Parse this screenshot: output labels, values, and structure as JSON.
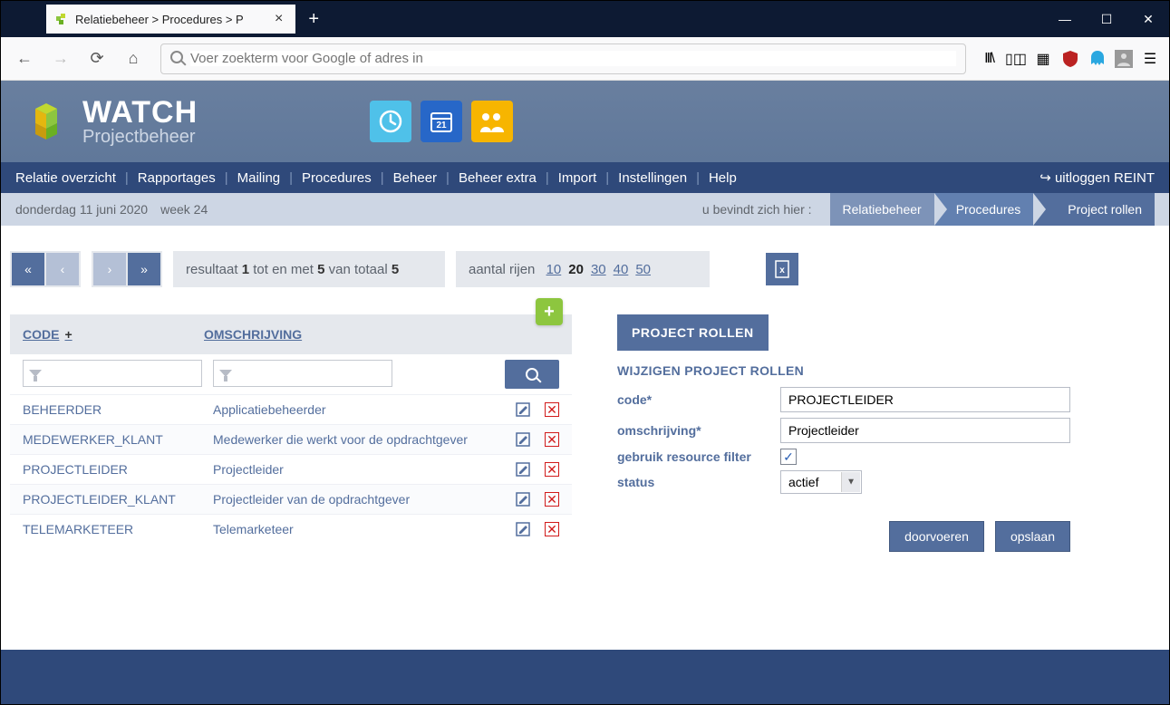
{
  "browser": {
    "tab_title": "Relatiebeheer > Procedures > P",
    "address_placeholder": "Voer zoekterm voor Google of adres in"
  },
  "app": {
    "logo_line1": "WATCH",
    "logo_line2": "Projectbeheer",
    "nav": [
      "Relatie overzicht",
      "Rapportages",
      "Mailing",
      "Procedures",
      "Beheer",
      "Beheer extra",
      "Import",
      "Instellingen",
      "Help"
    ],
    "logout": "uitloggen REINT"
  },
  "crumb": {
    "date": "donderdag 11 juni 2020",
    "week": "week 24",
    "location_label": "u bevindt zich hier :",
    "chain": [
      "Relatiebeheer",
      "Procedures",
      "Project rollen"
    ]
  },
  "results": {
    "prefix": "resultaat",
    "from": "1",
    "mid1": "tot en met",
    "to": "5",
    "mid2": "van totaal",
    "total": "5",
    "rows_label": "aantal rijen",
    "row_options": [
      "10",
      "20",
      "30",
      "40",
      "50"
    ],
    "selected_rows": "20"
  },
  "table": {
    "headers": {
      "code": "CODE",
      "desc": "OMSCHRIJVING"
    },
    "rows": [
      {
        "code": "BEHEERDER",
        "desc": "Applicatiebeheerder"
      },
      {
        "code": "MEDEWERKER_KLANT",
        "desc": "Medewerker die werkt voor de opdrachtgever"
      },
      {
        "code": "PROJECTLEIDER",
        "desc": "Projectleider"
      },
      {
        "code": "PROJECTLEIDER_KLANT",
        "desc": "Projectleider van de opdrachtgever"
      },
      {
        "code": "TELEMARKETEER",
        "desc": "Telemarketeer"
      }
    ]
  },
  "panel": {
    "title": "PROJECT ROLLEN",
    "heading": "WIJZIGEN PROJECT ROLLEN",
    "labels": {
      "code": "code*",
      "desc": "omschrijving*",
      "filter": "gebruik resource filter",
      "status": "status"
    },
    "values": {
      "code": "PROJECTLEIDER",
      "desc": "Projectleider",
      "filter": true,
      "status": "actief"
    },
    "buttons": {
      "apply": "doorvoeren",
      "save": "opslaan"
    }
  }
}
